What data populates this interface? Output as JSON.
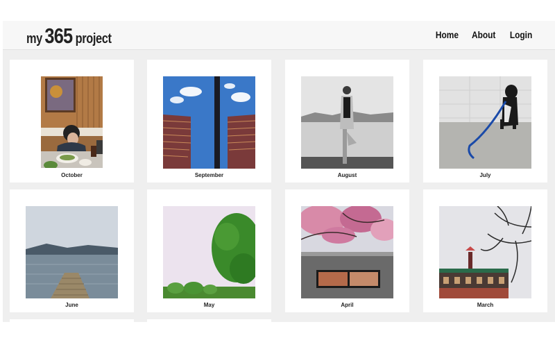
{
  "header": {
    "logo": {
      "prefix": "my",
      "number": "365",
      "suffix": "project"
    },
    "nav": [
      {
        "label": "Home"
      },
      {
        "label": "About"
      },
      {
        "label": "Login"
      }
    ]
  },
  "gallery": {
    "months": [
      {
        "label": "October"
      },
      {
        "label": "September"
      },
      {
        "label": "August"
      },
      {
        "label": "July"
      },
      {
        "label": "June"
      },
      {
        "label": "May"
      },
      {
        "label": "April"
      },
      {
        "label": "March"
      }
    ]
  },
  "colors": {
    "page_background": "#efefef",
    "header_background": "#f7f7f7",
    "card_background": "#ffffff",
    "text": "#222222"
  }
}
